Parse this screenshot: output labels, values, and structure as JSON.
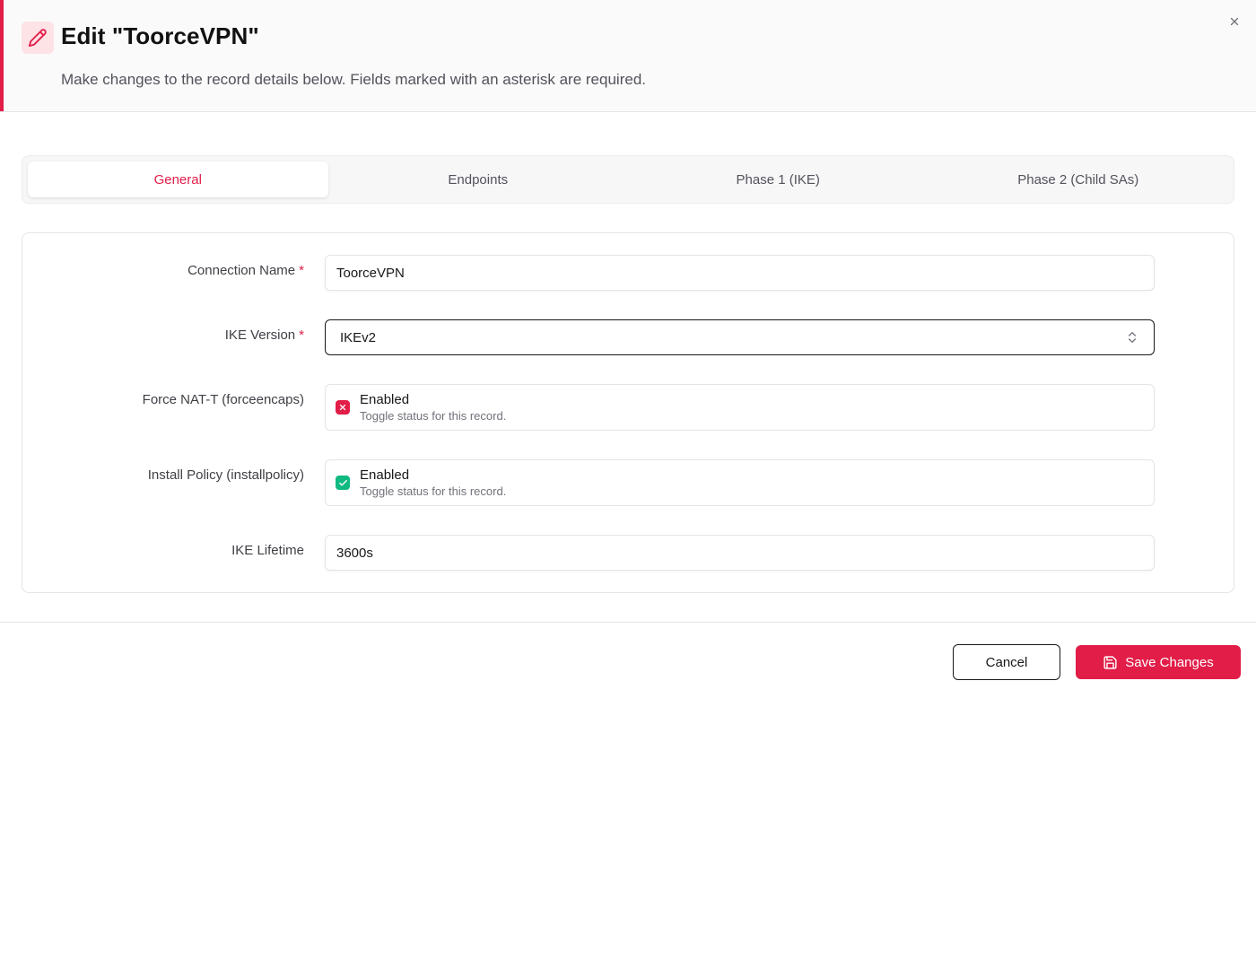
{
  "dialog": {
    "title": "Edit \"ToorceVPN\"",
    "subtitle": "Make changes to the record details below. Fields marked with an asterisk are required.",
    "edit_icon": "pencil-icon",
    "close_icon": "close-icon",
    "accent_color": "#e11d48"
  },
  "tabs": [
    {
      "label": "General",
      "active": true
    },
    {
      "label": "Endpoints",
      "active": false
    },
    {
      "label": "Phase 1 (IKE)",
      "active": false
    },
    {
      "label": "Phase 2 (Child SAs)",
      "active": false
    }
  ],
  "form": {
    "connection_name": {
      "label": "Connection Name",
      "required_mark": "*",
      "value": "ToorceVPN"
    },
    "ike_version": {
      "label": "IKE Version",
      "required_mark": "*",
      "value": "IKEv2",
      "icon": "chevron-up-down-icon"
    },
    "force_nat_t": {
      "label": "Force NAT-T (forceencaps)",
      "status": "Enabled",
      "hint": "Toggle status for this record.",
      "checked": false,
      "color": "#e11d48",
      "icon": "x-icon"
    },
    "install_policy": {
      "label": "Install Policy (installpolicy)",
      "status": "Enabled",
      "hint": "Toggle status for this record.",
      "checked": true,
      "color": "#10b981",
      "icon": "check-icon"
    },
    "ike_lifetime": {
      "label": "IKE Lifetime",
      "value": "3600s"
    }
  },
  "footer": {
    "cancel_label": "Cancel",
    "save_label": "Save Changes",
    "save_icon": "save-icon"
  }
}
